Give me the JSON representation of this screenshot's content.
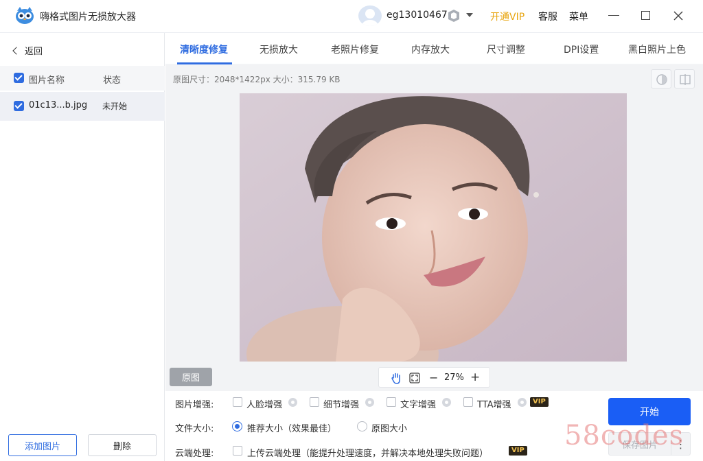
{
  "app": {
    "title": "嗨格式图片无损放大器"
  },
  "user": {
    "name": "eg13010467"
  },
  "header": {
    "vip_label": "开通VIP",
    "service_label": "客服",
    "menu_label": "菜单"
  },
  "sidebar": {
    "back_label": "返回",
    "columns": {
      "name": "图片名称",
      "status": "状态"
    },
    "files": [
      {
        "name": "01c13...b.jpg",
        "status": "未开始",
        "checked": true
      }
    ],
    "add_label": "添加图片",
    "delete_label": "删除"
  },
  "tabs": [
    {
      "label": "清晰度修复",
      "active": true
    },
    {
      "label": "无损放大",
      "active": false
    },
    {
      "label": "老照片修复",
      "active": false
    },
    {
      "label": "内存放大",
      "active": false
    },
    {
      "label": "尺寸调整",
      "active": false
    },
    {
      "label": "DPI设置",
      "active": false
    },
    {
      "label": "黑白照片上色",
      "active": false
    }
  ],
  "workspace": {
    "info": "原图尺寸：2048*1422px   大小：315.79 KB",
    "original_label": "原图",
    "zoom": "27%"
  },
  "options": {
    "enhance": {
      "label": "图片增强:",
      "items": [
        {
          "label": "人脸增强",
          "checked": false
        },
        {
          "label": "细节增强",
          "checked": false
        },
        {
          "label": "文字增强",
          "checked": false
        },
        {
          "label": "TTA增强",
          "checked": false
        }
      ]
    },
    "file_size": {
      "label": "文件大小:",
      "choices": [
        {
          "label": "推荐大小（效果最佳）",
          "selected": true
        },
        {
          "label": "原图大小",
          "selected": false
        }
      ]
    },
    "cloud": {
      "label": "云端处理:",
      "text": "上传云端处理（能提升处理速度，并解决本地处理失败问题）",
      "checked": false
    },
    "vip_badge": "VIP"
  },
  "actions": {
    "start_label": "开始",
    "save_label": "保存图片"
  },
  "watermark": "58codes",
  "colors": {
    "accent": "#2f6ce0",
    "start_button": "#1a5ef5",
    "vip": "#e8a510"
  }
}
